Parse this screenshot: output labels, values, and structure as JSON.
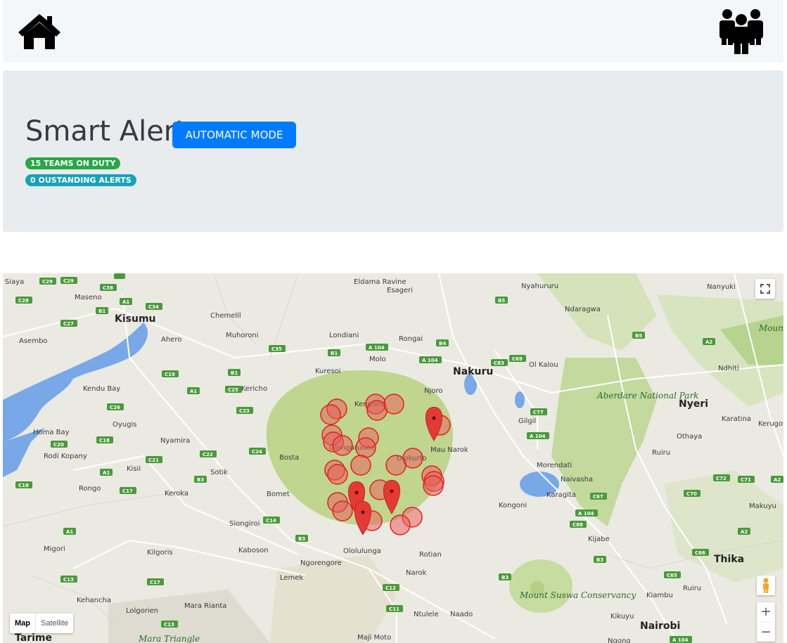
{
  "navbar": {
    "home_icon": "home-icon",
    "team_icon": "users-icon"
  },
  "header": {
    "title": "Smart Alert",
    "mode_button": "AUTOMATIC MODE",
    "badges": [
      "15 TEAMS ON DUTY",
      "0 OUSTANDING ALERTS"
    ]
  },
  "map": {
    "type_controls": [
      "Map",
      "Satellite"
    ],
    "zoom_in": "+",
    "zoom_out": "−",
    "towns": [
      "Siaya",
      "Maseno",
      "Eldama Ravine",
      "Esageri",
      "Nyahururu",
      "Nanyuki",
      "Ndaragwa",
      "Kisumu",
      "Chemelil",
      "Muhoroni",
      "Ahero",
      "Londiani",
      "Rongai",
      "Asembo",
      "Molo",
      "Nakuru",
      "Ol Kalou",
      "Ndhiti",
      "Kuresoi",
      "Kendu Bay",
      "Kericho",
      "Njoro",
      "Gilgil",
      "Nyeri",
      "Karatina",
      "Kerugoya",
      "Othaya",
      "Homa Bay",
      "Oyugis",
      "Nyamira",
      "Bosta",
      "Mau Narok",
      "Olokurto",
      "Olenguruone",
      "Kenyhet",
      "Rodi Kopany",
      "Kisii",
      "Sotik",
      "Morendati",
      "Naivasha",
      "Ruiru",
      "Rongo",
      "Keroka",
      "Bomet",
      "Karagita",
      "Kongoni",
      "Makuyu",
      "Siongiroi",
      "Kijabe",
      "Migori",
      "Kilgoris",
      "Kaboson",
      "Ololulunga",
      "Rotian",
      "Thika",
      "Ngorengore",
      "Lemek",
      "Narok",
      "Kehancha",
      "Mara Rianta",
      "Kiambu",
      "Lolgorien",
      "Ntulele",
      "Naado",
      "Kikuyu",
      "Nairobi",
      "Tarime",
      "Maji Moto",
      "Ngong",
      "Ruiru"
    ],
    "parks": [
      "Aberdare National Park",
      "Mount Suswa Conservancy",
      "Mara Triangle",
      "Mount Kenya National"
    ]
  }
}
